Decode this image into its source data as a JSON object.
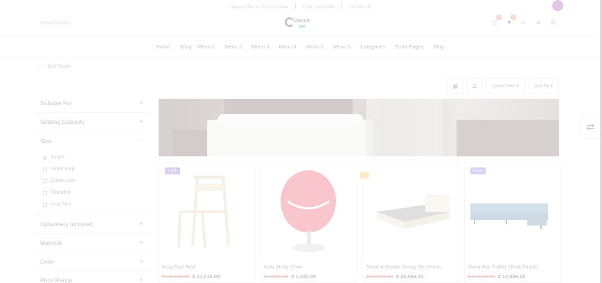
{
  "promo": {
    "offer": "Special Offer on First Purchase",
    "code": "Code : #ASDA44",
    "discount": "Get 50% Off"
  },
  "header": {
    "language": "English (US)",
    "logo_text": "Clarico",
    "cart_count": "0",
    "wishlist_count": "0"
  },
  "nav": {
    "items": [
      {
        "label": "Home",
        "dropdown": true
      },
      {
        "label": "Shop",
        "dropdown": false
      },
      {
        "label": "Menu 1",
        "dropdown": true
      },
      {
        "label": "Menu 2",
        "dropdown": true
      },
      {
        "label": "Menu 3",
        "dropdown": true
      },
      {
        "label": "Menu 4",
        "dropdown": true
      },
      {
        "label": "Menu 5",
        "dropdown": true
      },
      {
        "label": "Menu 6",
        "dropdown": true
      },
      {
        "label": "Categories",
        "dropdown": true
      },
      {
        "label": "Extra Pages",
        "dropdown": true
      },
      {
        "label": "Blog",
        "dropdown": false
      }
    ]
  },
  "breadcrumb": {
    "current": "Bed Room"
  },
  "toolbar": {
    "quick_filter": "Quick Filter",
    "sort_by": "Sort By"
  },
  "filters": {
    "suitable_for": "Suitable For",
    "seating_capacity": "Seating Capacity",
    "size": "Size",
    "size_options": [
      "Single",
      "Super King",
      "Queen Size",
      "Standard",
      "King Size"
    ],
    "upholstery": "Upholstery Included",
    "material": "Material",
    "color": "Color",
    "price_range": "Price Range"
  },
  "products": [
    {
      "name": "King Size Bed",
      "old_price": "$ 18,900.00",
      "price": "$ 17,010.00",
      "label": "Fresh"
    },
    {
      "name": "Kids Study Chair",
      "old_price": "$ 1,600.00",
      "price": "$ 1,440.00",
      "label": ""
    },
    {
      "name": "Steve 4 Seater Dining Set (Hone...",
      "old_price": "$ 27,299.00",
      "price": "$ 24,569.10",
      "label": ""
    },
    {
      "name": "Slany Bar Trolley (Teak Finish)",
      "old_price": "$ 13,999.00",
      "price": "$ 12,599.10",
      "label": "Fresh"
    }
  ],
  "colors": {
    "accent": "#7a4fd8",
    "badge": "#e3643b",
    "hot_label": "#f2b233",
    "old_price": "#bb3333"
  }
}
